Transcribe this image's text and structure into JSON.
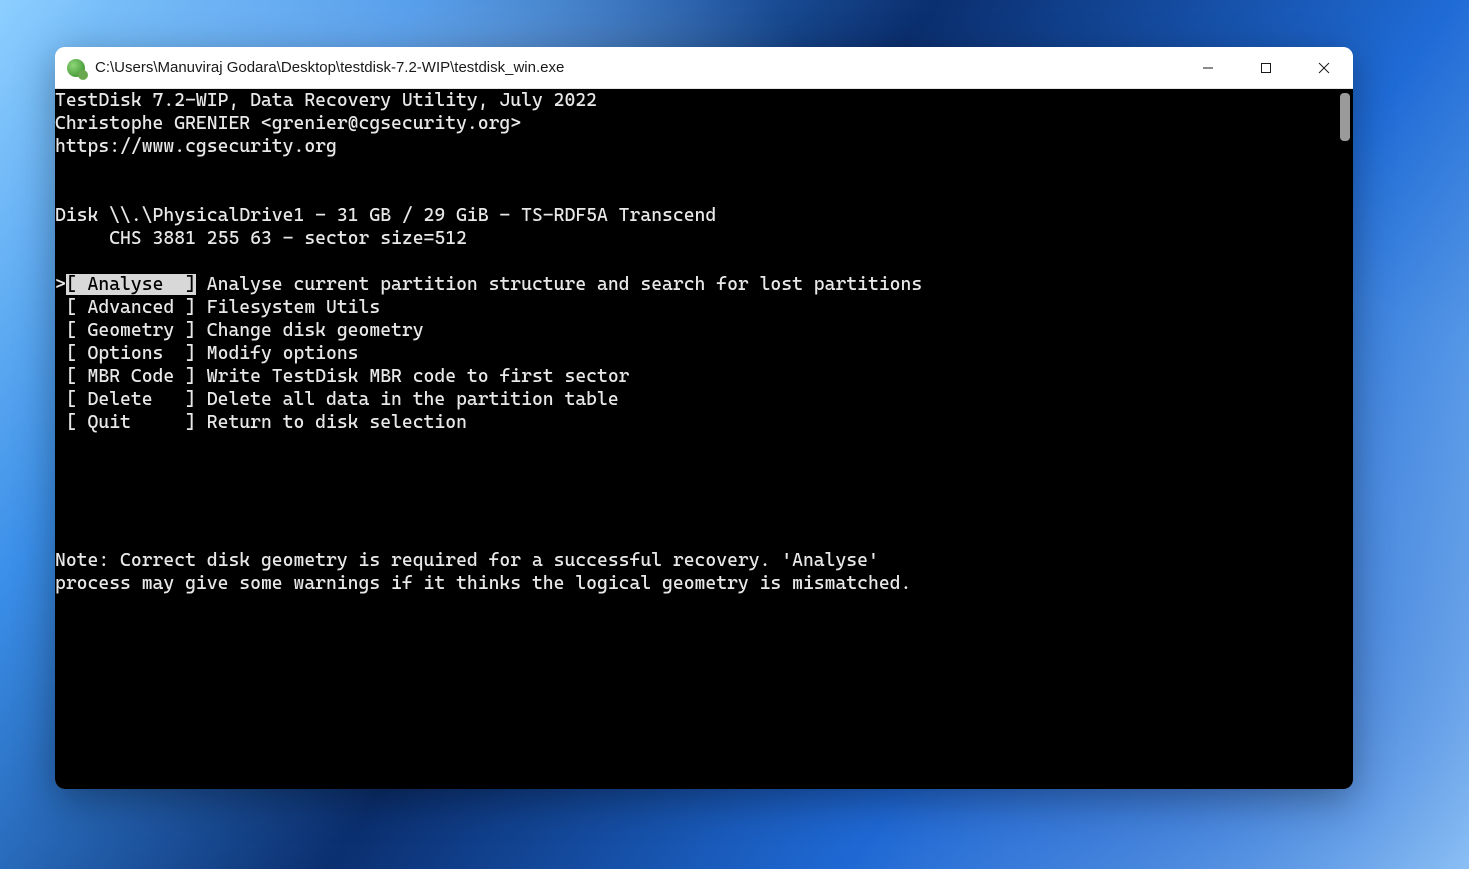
{
  "window": {
    "title": "C:\\Users\\Manuviraj Godara\\Desktop\\testdisk-7.2-WIP\\testdisk_win.exe"
  },
  "header": {
    "line1": "TestDisk 7.2-WIP, Data Recovery Utility, July 2022",
    "line2": "Christophe GRENIER <grenier@cgsecurity.org>",
    "line3": "https://www.cgsecurity.org"
  },
  "disk": {
    "line1": "Disk \\\\.\\PhysicalDrive1 - 31 GB / 29 GiB - TS-RDF5A Transcend",
    "line2": "     CHS 3881 255 63 - sector size=512"
  },
  "menu": {
    "marker": ">",
    "items": [
      {
        "label": "[ Analyse  ]",
        "desc": " Analyse current partition structure and search for lost partitions",
        "selected": true
      },
      {
        "label": " [ Advanced ]",
        "desc": " Filesystem Utils",
        "selected": false
      },
      {
        "label": " [ Geometry ]",
        "desc": " Change disk geometry",
        "selected": false
      },
      {
        "label": " [ Options  ]",
        "desc": " Modify options",
        "selected": false
      },
      {
        "label": " [ MBR Code ]",
        "desc": " Write TestDisk MBR code to first sector",
        "selected": false
      },
      {
        "label": " [ Delete   ]",
        "desc": " Delete all data in the partition table",
        "selected": false
      },
      {
        "label": " [ Quit     ]",
        "desc": " Return to disk selection",
        "selected": false
      }
    ]
  },
  "note": {
    "line1": "Note: Correct disk geometry is required for a successful recovery. 'Analyse'",
    "line2": "process may give some warnings if it thinks the logical geometry is mismatched."
  }
}
